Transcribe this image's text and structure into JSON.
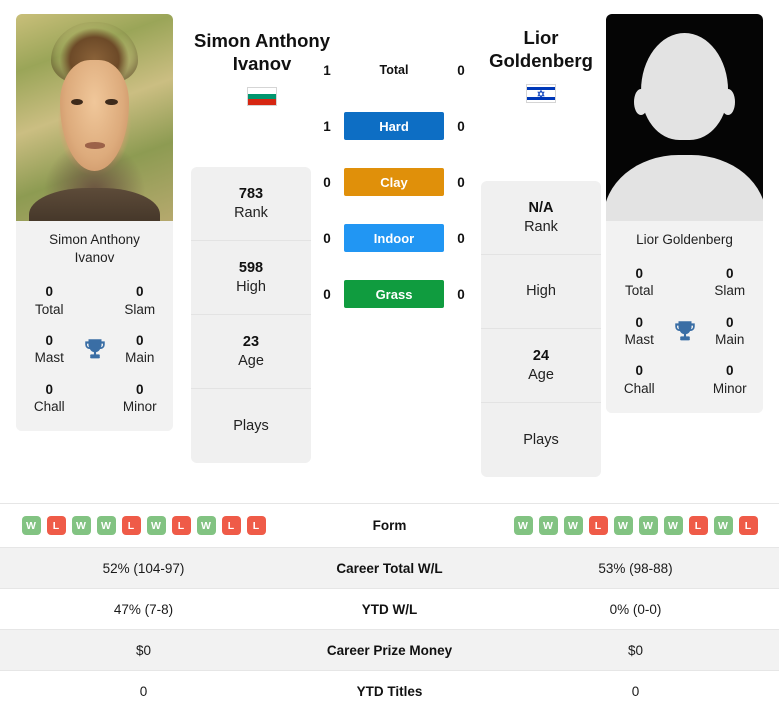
{
  "players": {
    "left": {
      "name": "Simon Anthony Ivanov",
      "name_line1": "Simon Anthony",
      "name_line2": "Ivanov",
      "caption_line1": "Simon Anthony",
      "caption_line2": "Ivanov",
      "country": "Bulgaria",
      "flag_icon": "flag-bulgaria-icon",
      "avatar_type": "photo",
      "titles": {
        "total_value": "0",
        "total_label": "Total",
        "slam_value": "0",
        "slam_label": "Slam",
        "mast_value": "0",
        "mast_label": "Mast",
        "main_value": "0",
        "main_label": "Main",
        "chall_value": "0",
        "chall_label": "Chall",
        "minor_value": "0",
        "minor_label": "Minor"
      },
      "profile": {
        "rank_value": "783",
        "rank_label": "Rank",
        "high_value": "598",
        "high_label": "High",
        "age_value": "23",
        "age_label": "Age",
        "plays_value": "",
        "plays_label": "Plays"
      },
      "surface_wins": {
        "total": "1",
        "hard": "1",
        "clay": "0",
        "indoor": "0",
        "grass": "0"
      },
      "form": [
        "W",
        "L",
        "W",
        "W",
        "L",
        "W",
        "L",
        "W",
        "L",
        "L"
      ],
      "career_total_wl": "52% (104-97)",
      "ytd_wl": "47% (7-8)",
      "career_prize_money": "$0",
      "ytd_titles": "0"
    },
    "right": {
      "name": "Lior Goldenberg",
      "name_line1": "Lior",
      "name_line2": "Goldenberg",
      "caption_line1": "Lior Goldenberg",
      "caption_line2": "",
      "country": "Israel",
      "flag_icon": "flag-israel-icon",
      "avatar_type": "placeholder-silhouette",
      "titles": {
        "total_value": "0",
        "total_label": "Total",
        "slam_value": "0",
        "slam_label": "Slam",
        "mast_value": "0",
        "mast_label": "Mast",
        "main_value": "0",
        "main_label": "Main",
        "chall_value": "0",
        "chall_label": "Chall",
        "minor_value": "0",
        "minor_label": "Minor"
      },
      "profile": {
        "rank_value": "N/A",
        "rank_label": "Rank",
        "high_value": "",
        "high_label": "High",
        "age_value": "24",
        "age_label": "Age",
        "plays_value": "",
        "plays_label": "Plays"
      },
      "surface_wins": {
        "total": "0",
        "hard": "0",
        "clay": "0",
        "indoor": "0",
        "grass": "0"
      },
      "form": [
        "W",
        "W",
        "W",
        "L",
        "W",
        "W",
        "W",
        "L",
        "W",
        "L"
      ],
      "career_total_wl": "53% (98-88)",
      "ytd_wl": "0% (0-0)",
      "career_prize_money": "$0",
      "ytd_titles": "0"
    }
  },
  "surfaces": [
    {
      "key": "total",
      "label": "Total",
      "color": "transparent",
      "plain": true
    },
    {
      "key": "hard",
      "label": "Hard",
      "color": "#0d6ec4",
      "plain": false
    },
    {
      "key": "clay",
      "label": "Clay",
      "color": "#e0900a",
      "plain": false
    },
    {
      "key": "indoor",
      "label": "Indoor",
      "color": "#2196f3",
      "plain": false
    },
    {
      "key": "grass",
      "label": "Grass",
      "color": "#109c3f",
      "plain": false
    }
  ],
  "comparison_rows": [
    {
      "label": "Form",
      "left": "",
      "right": ""
    },
    {
      "label": "Career Total W/L",
      "left": "52% (104-97)",
      "right": "53% (98-88)"
    },
    {
      "label": "YTD W/L",
      "left": "47% (7-8)",
      "right": "0% (0-0)"
    },
    {
      "label": "Career Prize Money",
      "left": "$0",
      "right": "$0"
    },
    {
      "label": "YTD Titles",
      "left": "0",
      "right": "0"
    }
  ],
  "labels": {
    "form": "Form",
    "career_total_wl": "Career Total W/L",
    "ytd_wl": "YTD W/L",
    "career_prize_money": "Career Prize Money",
    "ytd_titles": "YTD Titles",
    "win": "W",
    "loss": "L"
  },
  "colors": {
    "hard": "#0d6ec4",
    "clay": "#e0900a",
    "indoor": "#2196f3",
    "grass": "#109c3f",
    "win": "#82c382",
    "loss": "#ef5b48",
    "trophy": "#3a6ea5",
    "panel": "#f2f2f2"
  }
}
